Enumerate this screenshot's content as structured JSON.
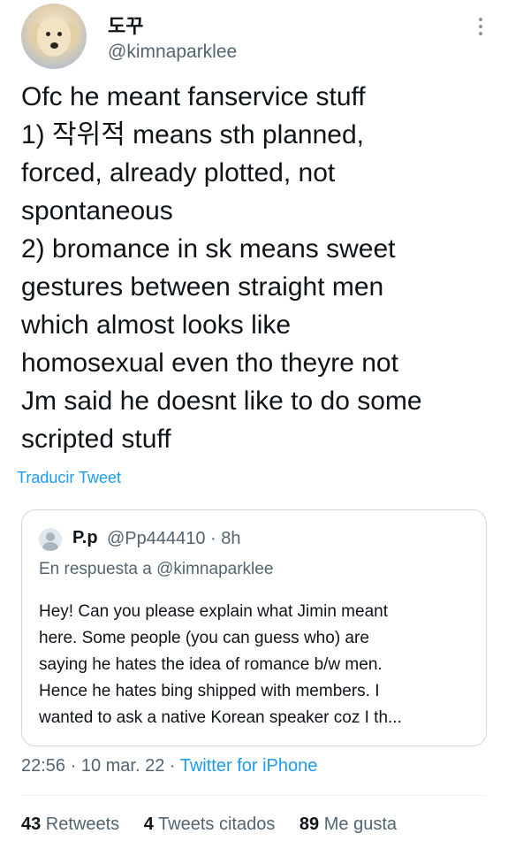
{
  "author": {
    "display_name": "도꾸",
    "handle": "@kimnaparklee",
    "avatar_icon": "dog-avatar-icon"
  },
  "more_icon": "more-vertical-icon",
  "tweet": {
    "lines": [
      "Ofc he meant fanservice stuff",
      "1) 작위적 means sth planned,",
      "forced, already plotted, not",
      "spontaneous",
      "2) bromance in sk means sweet",
      "gestures between straight men",
      "which almost looks like",
      "homosexual even tho theyre not",
      "Jm said he doesnt like to do some",
      "scripted stuff"
    ],
    "translate_label": "Traducir Tweet"
  },
  "quoted": {
    "name": "P.p",
    "handle_time": "@Pp444410 · 8h",
    "reply_prefix": "En respuesta a ",
    "reply_mention": "@kimnaparklee",
    "body_lines": [
      "Hey! Can you please explain what Jimin meant",
      "here. Some people (you can guess who) are",
      "saying he hates the idea of romance b/w men.",
      "Hence he hates bing shipped with members. I",
      "wanted to ask a native Korean speaker coz I th..."
    ]
  },
  "meta": {
    "time_date": "22:56 · 10 mar. 22 · ",
    "client": "Twitter for iPhone"
  },
  "stats": {
    "retweets_count": "43",
    "retweets_label": " Retweets",
    "quotes_count": "4",
    "quotes_label": " Tweets citados",
    "likes_count": "89",
    "likes_label": " Me gusta"
  },
  "colors": {
    "link": "#1d9bf0",
    "secondary_text": "#536471",
    "primary_text": "#0f1419",
    "border": "#cfd9de"
  }
}
